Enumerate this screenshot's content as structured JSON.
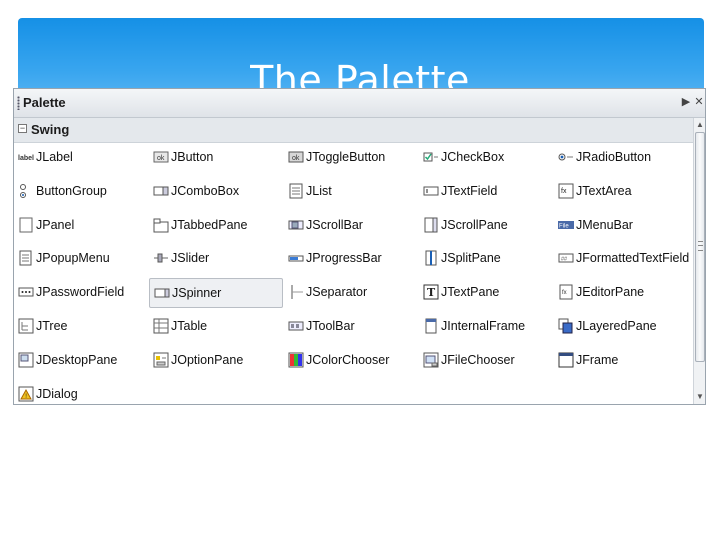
{
  "slide": {
    "title": "The Palette"
  },
  "palette": {
    "title": "Palette",
    "header_buttons": {
      "pin": "▶",
      "close": "✕"
    },
    "category": {
      "label": "Swing",
      "expanded": true
    },
    "items": [
      {
        "label": "JLabel",
        "icon": "label-icon"
      },
      {
        "label": "JButton",
        "icon": "button-icon"
      },
      {
        "label": "JToggleButton",
        "icon": "toggle-button-icon"
      },
      {
        "label": "JCheckBox",
        "icon": "checkbox-icon"
      },
      {
        "label": "JRadioButton",
        "icon": "radio-button-icon"
      },
      {
        "label": "ButtonGroup",
        "icon": "button-group-icon"
      },
      {
        "label": "JComboBox",
        "icon": "combobox-icon"
      },
      {
        "label": "JList",
        "icon": "list-icon"
      },
      {
        "label": "JTextField",
        "icon": "text-field-icon"
      },
      {
        "label": "JTextArea",
        "icon": "text-area-icon"
      },
      {
        "label": "JPanel",
        "icon": "panel-icon"
      },
      {
        "label": "JTabbedPane",
        "icon": "tabbed-pane-icon"
      },
      {
        "label": "JScrollBar",
        "icon": "scrollbar-icon"
      },
      {
        "label": "JScrollPane",
        "icon": "scroll-pane-icon"
      },
      {
        "label": "JMenuBar",
        "icon": "menu-bar-icon"
      },
      {
        "label": "JPopupMenu",
        "icon": "popup-menu-icon"
      },
      {
        "label": "JSlider",
        "icon": "slider-icon"
      },
      {
        "label": "JProgressBar",
        "icon": "progress-bar-icon"
      },
      {
        "label": "JSplitPane",
        "icon": "split-pane-icon"
      },
      {
        "label": "JFormattedTextField",
        "icon": "formatted-text-field-icon"
      },
      {
        "label": "JPasswordField",
        "icon": "password-field-icon"
      },
      {
        "label": "JSpinner",
        "icon": "spinner-icon",
        "selected": true
      },
      {
        "label": "JSeparator",
        "icon": "separator-icon"
      },
      {
        "label": "JTextPane",
        "icon": "text-pane-icon"
      },
      {
        "label": "JEditorPane",
        "icon": "editor-pane-icon"
      },
      {
        "label": "JTree",
        "icon": "tree-icon"
      },
      {
        "label": "JTable",
        "icon": "table-icon"
      },
      {
        "label": "JToolBar",
        "icon": "toolbar-icon"
      },
      {
        "label": "JInternalFrame",
        "icon": "internal-frame-icon"
      },
      {
        "label": "JLayeredPane",
        "icon": "layered-pane-icon"
      },
      {
        "label": "JDesktopPane",
        "icon": "desktop-pane-icon"
      },
      {
        "label": "JOptionPane",
        "icon": "option-pane-icon"
      },
      {
        "label": "JColorChooser",
        "icon": "color-chooser-icon"
      },
      {
        "label": "JFileChooser",
        "icon": "file-chooser-icon"
      },
      {
        "label": "JFrame",
        "icon": "frame-icon"
      },
      {
        "label": "JDialog",
        "icon": "dialog-icon"
      }
    ]
  },
  "colors": {
    "banner": "#2a9cec",
    "selection": "#eef0f3"
  }
}
